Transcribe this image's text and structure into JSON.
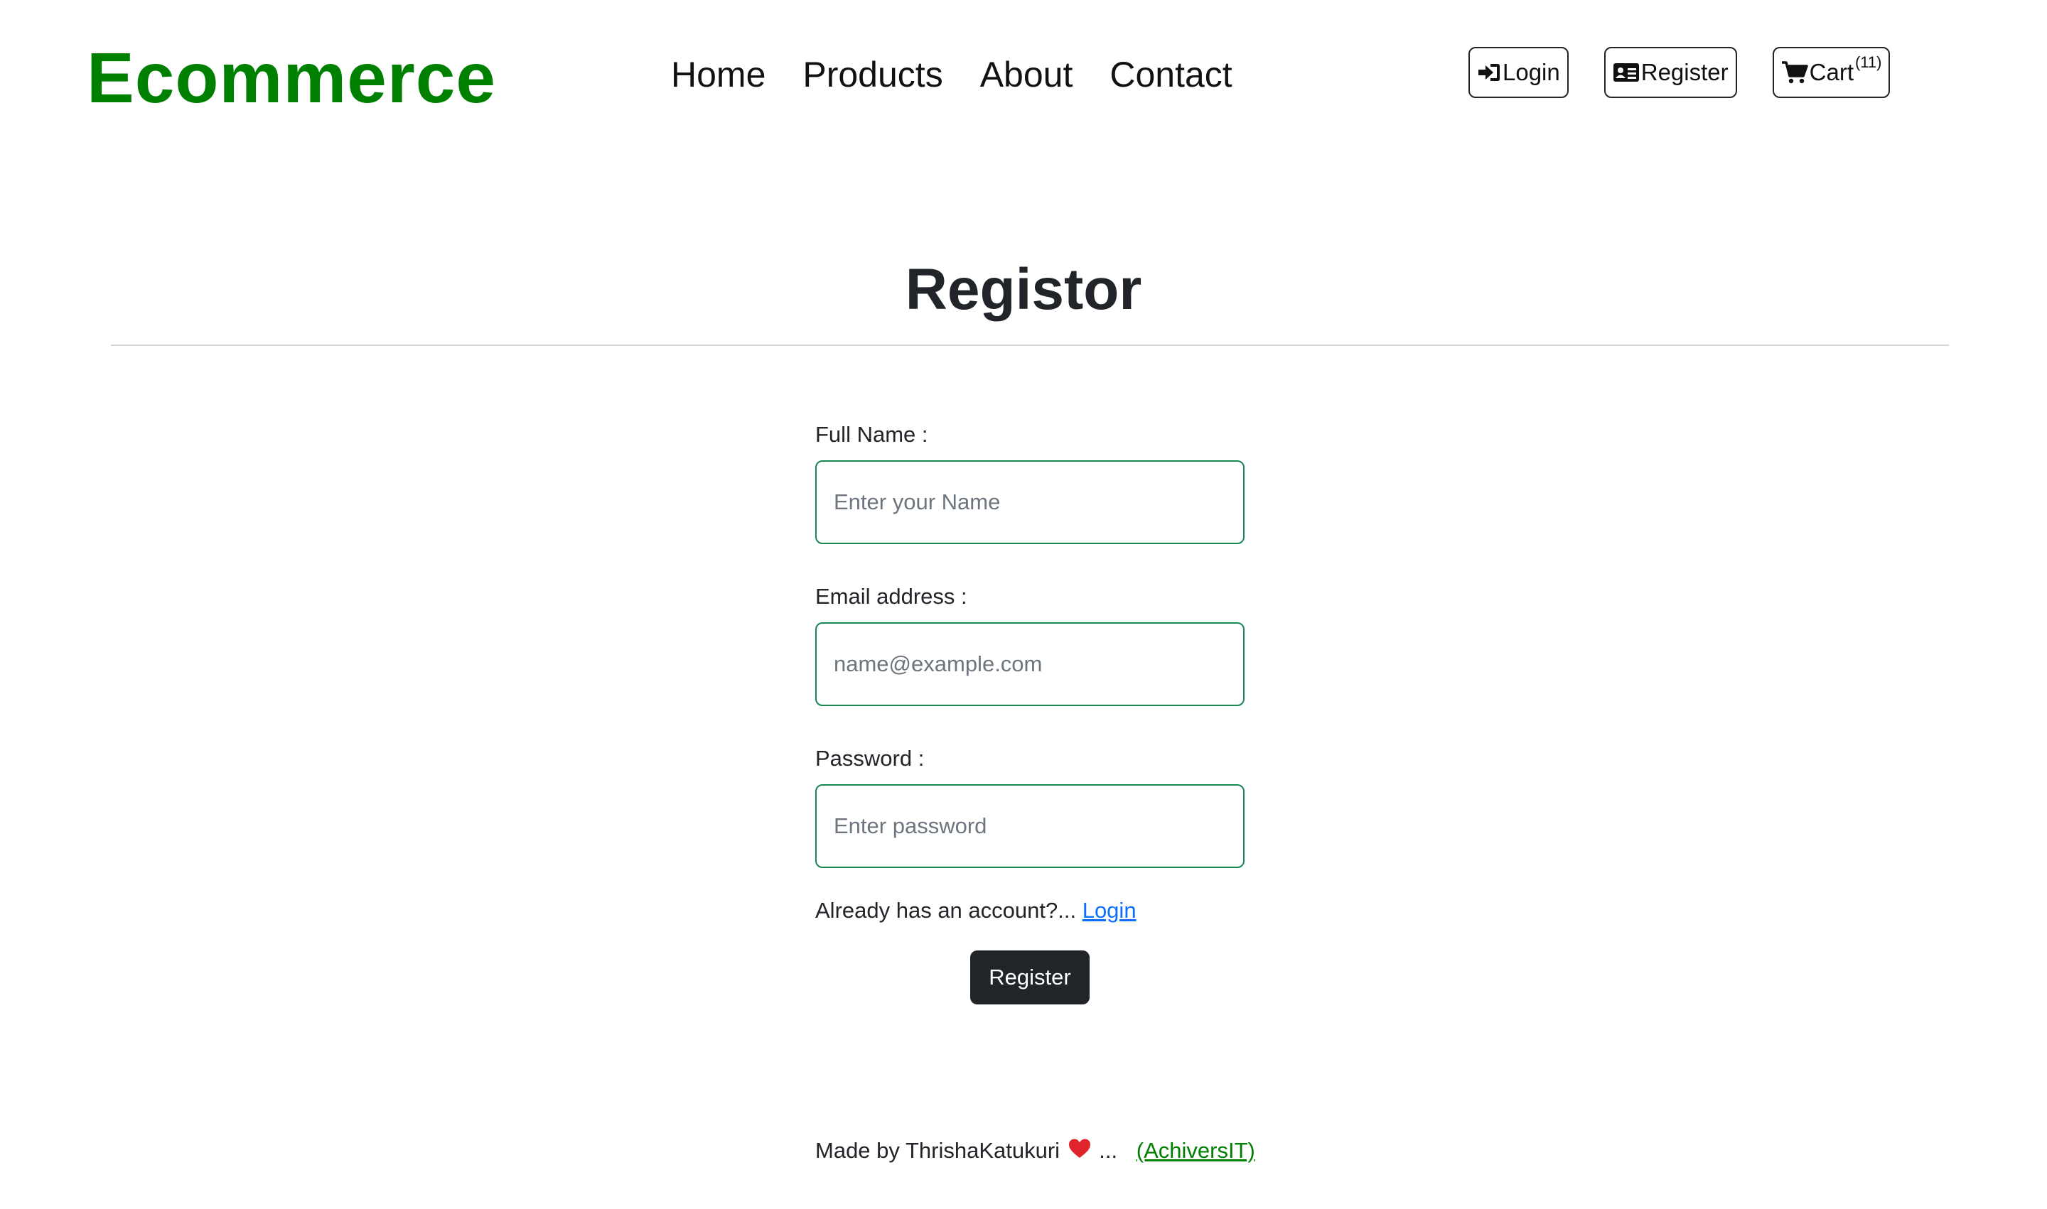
{
  "brand": "Ecommerce",
  "nav": {
    "links": [
      {
        "label": "Home"
      },
      {
        "label": "Products"
      },
      {
        "label": "About"
      },
      {
        "label": "Contact"
      }
    ],
    "login_label": "Login",
    "register_label": "Register",
    "cart_label": "Cart",
    "cart_count": "(11)",
    "icons": {
      "login": "sign-in-icon",
      "register": "id-card-icon",
      "cart": "shopping-cart-icon"
    }
  },
  "page_title": "Registor",
  "form": {
    "full_name": {
      "label": "Full Name :",
      "placeholder": "Enter your Name",
      "value": ""
    },
    "email": {
      "label": "Email address :",
      "placeholder": "name@example.com",
      "value": ""
    },
    "password": {
      "label": "Password :",
      "placeholder": "Enter password",
      "value": ""
    },
    "account_prompt": "Already has an account?...",
    "login_link": "Login",
    "submit_label": "Register"
  },
  "footer": {
    "made_by": "Made by ThrishaKatukuri",
    "ellipsis": "...",
    "link": "(AchiversIT)",
    "icon": "heart-icon"
  },
  "colors": {
    "brand": "#008000",
    "input_border": "#198754",
    "link": "#0d6efd",
    "button_bg": "#212529",
    "heart": "#e0242b"
  }
}
